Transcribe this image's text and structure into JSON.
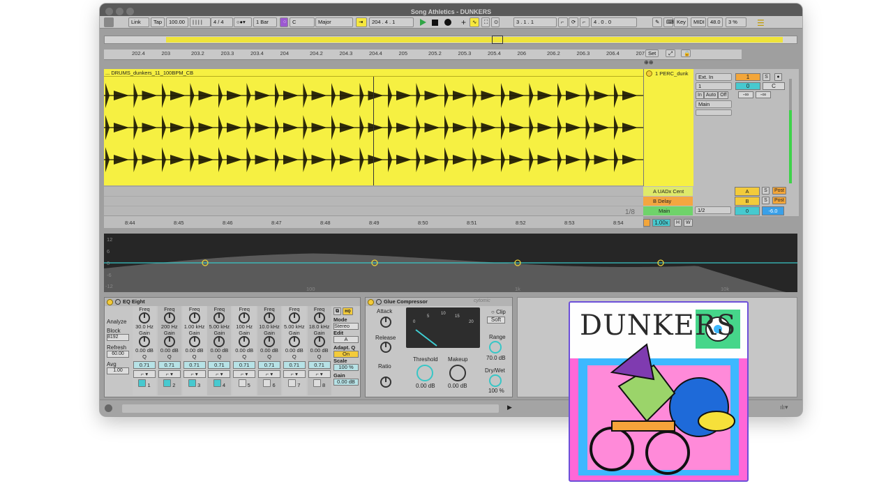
{
  "window": {
    "title": "Song Athletics - DUNKERS"
  },
  "transport": {
    "link": "Link",
    "tap": "Tap",
    "tempo": "100.00",
    "signature": "4 / 4",
    "quantize": "1 Bar",
    "key": "C",
    "scale": "Major",
    "position": "204 .  4 .  1",
    "loop_start": "3 .  1 .  1",
    "loop_length": "4 .  0 .  0",
    "key_label": "Key",
    "midi_label": "MIDI",
    "cpu_value": "48.0",
    "cpu_pct": "3 %"
  },
  "arrangement": {
    "bar_ticks": [
      "202.4",
      "203",
      "203.2",
      "203.3",
      "203.4",
      "204",
      "204.2",
      "204.3",
      "204.4",
      "205",
      "205.2",
      "205.3",
      "205.4",
      "206",
      "206.2",
      "206.3",
      "206.4",
      "207"
    ],
    "time_ticks": [
      "8:44",
      "8:45",
      "8:46",
      "8:47",
      "8:48",
      "8:49",
      "8:50",
      "8:51",
      "8:52",
      "8:53",
      "8:54"
    ],
    "set_label": "Set",
    "clip_name": "... DRUMS_dunkers_11_100BPM_CB",
    "zoom_label": "1/8"
  },
  "mixer": {
    "track_name": "1 PERC_dunk",
    "input_type": "Ext. In",
    "input_channel": "1",
    "monitor": [
      "In",
      "Auto",
      "Off"
    ],
    "output": "Main",
    "track_number": "1",
    "solo": "S",
    "volume": "0",
    "pan": "C",
    "send_a": "-∞",
    "send_b": "-∞",
    "returns": [
      {
        "name": "A UADx Cent",
        "letter": "A",
        "solo": "S",
        "post": "Post",
        "color": "#dfe96a"
      },
      {
        "name": "B Delay",
        "letter": "B",
        "solo": "S",
        "post": "Post",
        "color": "#f4a640"
      }
    ],
    "main": {
      "name": "Main",
      "cue": "1/2",
      "volume": "0",
      "level": "-6.0"
    },
    "tempo_factor": "1.00x",
    "h_label": "H",
    "w_label": "W"
  },
  "spectrum": {
    "db_labels": [
      "12",
      "6",
      "0",
      "-6",
      "-12"
    ],
    "freq_labels": [
      "100",
      "1k",
      "10k"
    ]
  },
  "eq_eight": {
    "title": "EQ Eight",
    "analyze": "Analyze",
    "block_label": "Block",
    "block_value": "8192",
    "refresh_label": "Refresh",
    "refresh_value": "60.00",
    "avg_label": "Avg",
    "avg_value": "1.00",
    "bands": [
      {
        "num": "1",
        "freq": "30.0 Hz",
        "gain": "0.00 dB",
        "q": "0.71"
      },
      {
        "num": "2",
        "freq": "200 Hz",
        "gain": "0.00 dB",
        "q": "0.71"
      },
      {
        "num": "3",
        "freq": "1.00 kHz",
        "gain": "0.00 dB",
        "q": "0.71"
      },
      {
        "num": "4",
        "freq": "5.00 kHz",
        "gain": "0.00 dB",
        "q": "0.71"
      },
      {
        "num": "5",
        "freq": "100 Hz",
        "gain": "0.00 dB",
        "q": "0.71"
      },
      {
        "num": "6",
        "freq": "10.0 kHz",
        "gain": "0.00 dB",
        "q": "0.71"
      },
      {
        "num": "7",
        "freq": "5.00 kHz",
        "gain": "0.00 dB",
        "q": "0.71"
      },
      {
        "num": "8",
        "freq": "18.0 kHz",
        "gain": "0.00 dB",
        "q": "0.71"
      }
    ],
    "freq_label": "Freq",
    "gain_label": "Gain",
    "q_label": "Q",
    "mode_label": "Mode",
    "mode_value": "Stereo",
    "edit_label": "Edit",
    "edit_value": "A",
    "adapt_label": "Adapt. Q",
    "adapt_value": "On",
    "scale_label": "Scale",
    "scale_value": "100 %",
    "out_gain_label": "Gain",
    "out_gain_value": "0.00 dB"
  },
  "glue": {
    "title": "Glue Compressor",
    "brand": "cytomic",
    "attack_label": "Attack",
    "release_label": "Release",
    "ratio_label": "Ratio",
    "clip_label": "Clip",
    "soft_label": "Soft",
    "meter_labels": [
      "0",
      "5",
      "10",
      "15",
      "20"
    ],
    "threshold_label": "Threshold",
    "threshold_value": "0.00 dB",
    "makeup_label": "Makeup",
    "makeup_value": "0.00 dB",
    "range_label": "Range",
    "range_value": "70.0 dB",
    "drywet_label": "Dry/Wet",
    "drywet_value": "100 %"
  },
  "album": {
    "title": "DUNKERS"
  },
  "colors": {
    "clip": "#f6f042",
    "accent": "#f3cb3b",
    "eq_value": "#b7e2e6",
    "spectrum": "#3b3b3b",
    "eq_line": "#38c6c6"
  }
}
